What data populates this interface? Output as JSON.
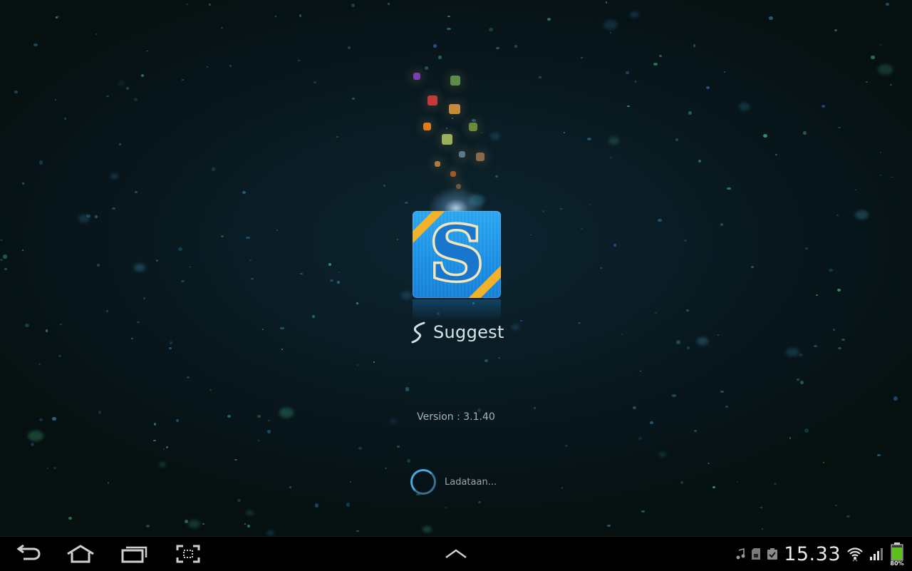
{
  "splash": {
    "app_name": "Suggest",
    "logo_letter": "S",
    "version_text": "Version : 3.1.40",
    "loading_text": "Ladataan..."
  },
  "icons": {
    "logo": "suggest-logo",
    "brand_mark": "samsung-s-icon",
    "spinner": "loading-spinner-icon"
  },
  "navbar": {
    "back": "back-icon",
    "home": "home-icon",
    "recents": "recent-apps-icon",
    "screenshot": "screen-capture-icon",
    "expand": "chevron-up-icon"
  },
  "status_bar": {
    "time": "15.33",
    "battery_percent": "80%",
    "battery_level": 0.8,
    "notification_icons": [
      "music-note-icon",
      "sd-card-icon",
      "clipboard-check-icon"
    ],
    "wifi": "wifi-icon",
    "signal": "signal-icon"
  },
  "colors": {
    "background": "#0a1c24",
    "logo_blue": "#2aa6f0",
    "logo_accent": "#f2b22a",
    "text_light": "#d8e4ea"
  }
}
